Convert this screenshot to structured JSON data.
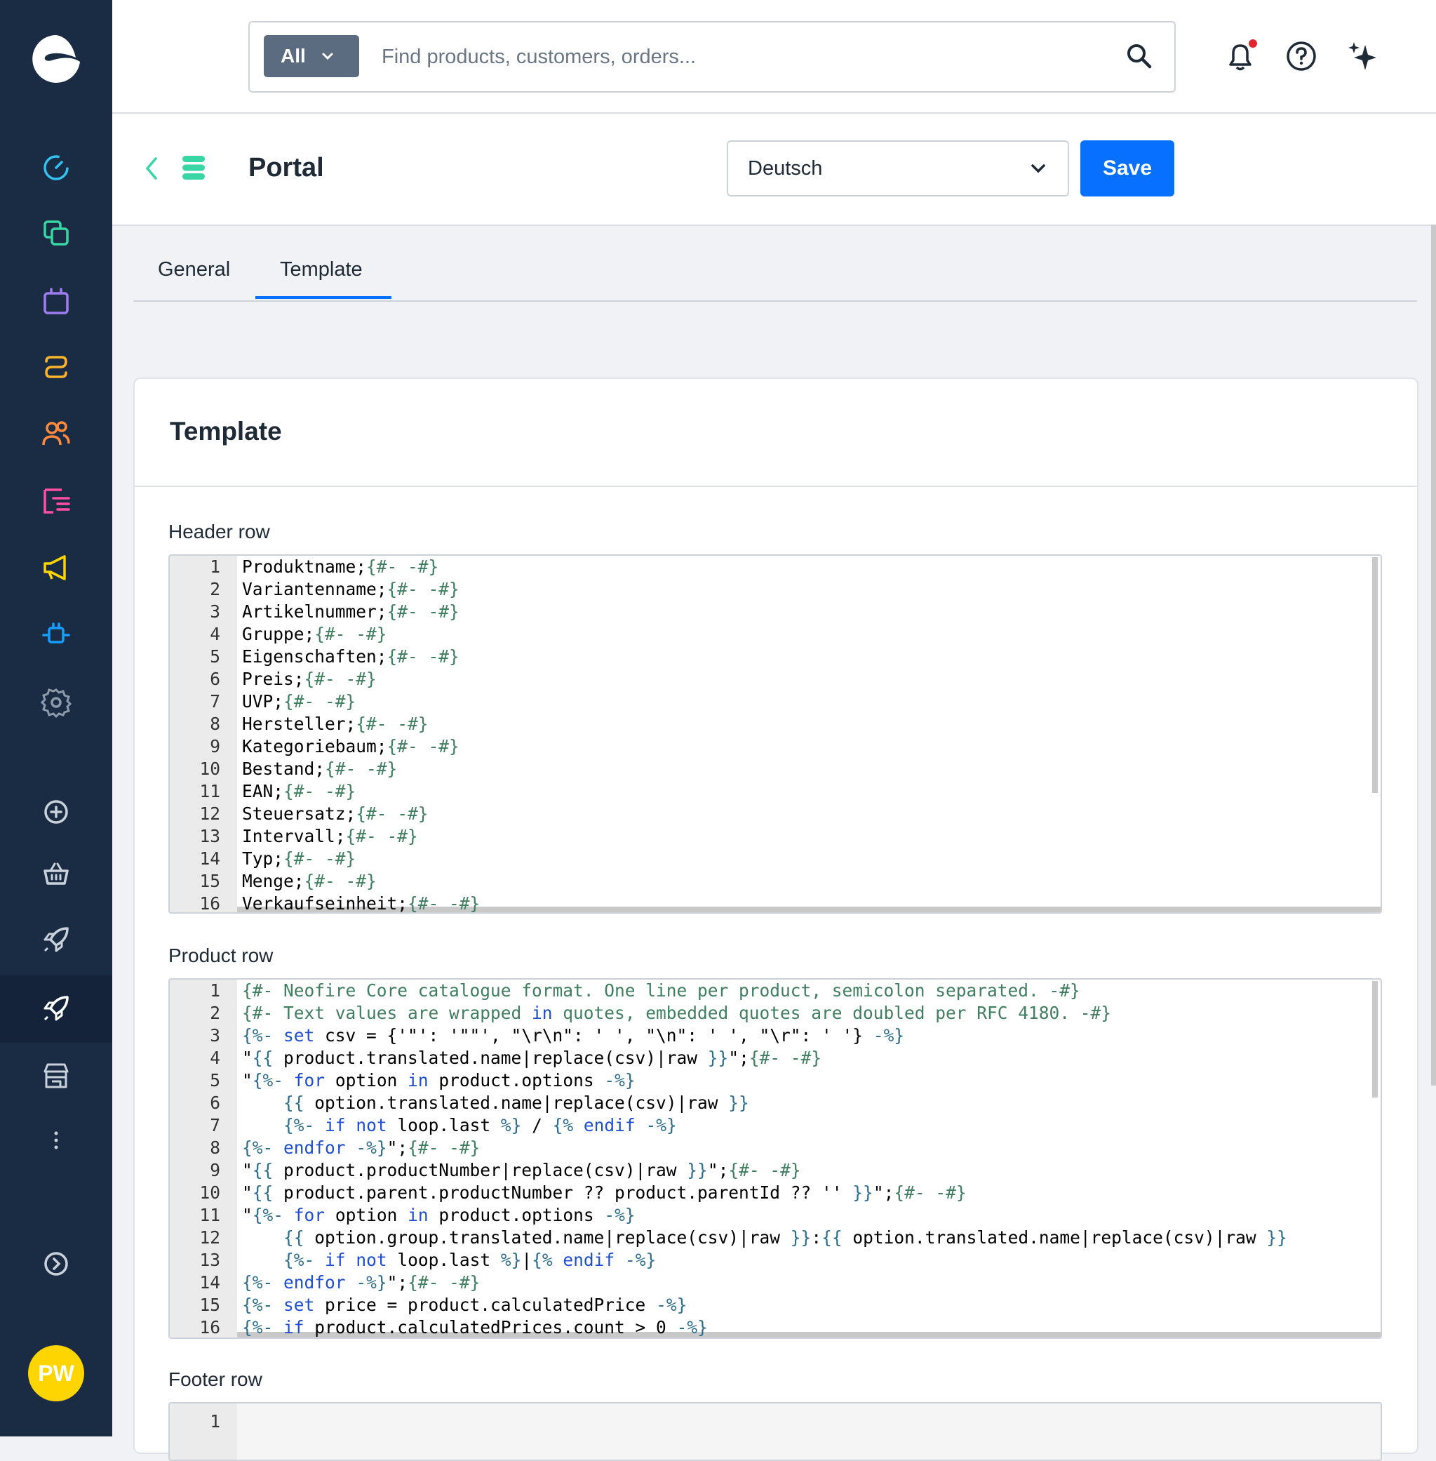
{
  "app": {
    "user_initials": "PW"
  },
  "search": {
    "scope": "All",
    "placeholder": "Find products, customers, orders..."
  },
  "header": {
    "title": "Portal",
    "language": "Deutsch",
    "save_label": "Save"
  },
  "tabs": [
    {
      "label": "General"
    },
    {
      "label": "Template"
    }
  ],
  "card": {
    "title": "Template"
  },
  "fields": {
    "header_row": "Header row",
    "product_row": "Product row",
    "footer_row": "Footer row"
  },
  "sidebar": {
    "items": [
      "dashboard-icon",
      "catalogue-icon",
      "orders-icon",
      "customers-icon",
      "persons-icon",
      "content-icon",
      "marketing-icon",
      "extensions-icon",
      "settings-icon",
      "add-icon",
      "basket-icon",
      "rocket-icon",
      "rocket-active-icon",
      "store-icon",
      "more-icon",
      "expand-icon"
    ]
  },
  "editors": {
    "header": [
      "Produktname;{#- -#}",
      "Variantenname;{#- -#}",
      "Artikelnummer;{#- -#}",
      "Gruppe;{#- -#}",
      "Eigenschaften;{#- -#}",
      "Preis;{#- -#}",
      "UVP;{#- -#}",
      "Hersteller;{#- -#}",
      "Kategoriebaum;{#- -#}",
      "Bestand;{#- -#}",
      "EAN;{#- -#}",
      "Steuersatz;{#- -#}",
      "Intervall;{#- -#}",
      "Typ;{#- -#}",
      "Menge;{#- -#}",
      "Verkaufseinheit;{#- -#}"
    ],
    "product": [
      "{#- Neofire Core catalogue format. One line per product, semicolon separated. -#}",
      "{#- Text values are wrapped in quotes, embedded quotes are doubled per RFC 4180. -#}",
      "{%- set csv = {'\"': '\"\"', \"\\r\\n\": ' ', \"\\n\": ' ', \"\\r\": ' '} -%}",
      "\"{{ product.translated.name|replace(csv)|raw }}\";{#- -#}",
      "\"{%- for option in product.options -%}",
      "    {{ option.translated.name|replace(csv)|raw }}",
      "    {%- if not loop.last %} / {% endif -%}",
      "{%- endfor -%}\";{#- -#}",
      "\"{{ product.productNumber|replace(csv)|raw }}\";{#- -#}",
      "\"{{ product.parent.productNumber ?? product.parentId ?? '' }}\";{#- -#}",
      "\"{%- for option in product.options -%}",
      "    {{ option.group.translated.name|replace(csv)|raw }}:{{ option.translated.name|replace(csv)|raw }}",
      "    {%- if not loop.last %}|{% endif -%}",
      "{%- endfor -%}\";{#- -#}",
      "{%- set price = product.calculatedPrice -%}",
      "{%- if product.calculatedPrices.count > 0 -%}"
    ],
    "footer": [
      ""
    ]
  }
}
